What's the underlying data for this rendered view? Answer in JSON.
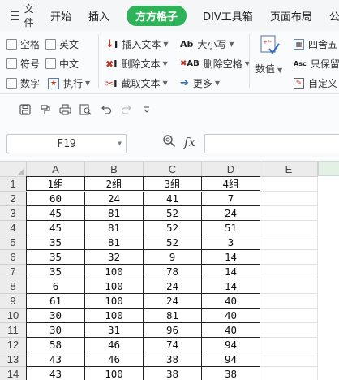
{
  "menu": {
    "file_label": "文件",
    "tabs": [
      "开始",
      "插入",
      "方方格子",
      "DIV工具箱",
      "页面布局",
      "公"
    ],
    "active_tab": "方方格子",
    "accent_color": "#2fb35a"
  },
  "ribbon": {
    "checkboxes": [
      "空格",
      "英文",
      "符号",
      "中文",
      "数字"
    ],
    "execute_label": "执行",
    "text_tools": [
      "插入文本",
      "删除文本",
      "截取文本"
    ],
    "case_tools": [
      "大小写",
      "删除空格",
      "更多"
    ],
    "numeric_label": "数值",
    "right_tools": [
      "四舍五",
      "只保留",
      "自定义"
    ]
  },
  "quick_access": {
    "icons": [
      "save-icon",
      "brush-icon",
      "print-icon",
      "print-preview-icon",
      "undo-icon",
      "redo-icon",
      "customize-icon"
    ]
  },
  "formula_bar": {
    "cell_ref": "F19",
    "fx_label": "fx",
    "formula": ""
  },
  "sheet": {
    "columns": [
      "A",
      "B",
      "C",
      "D",
      "E"
    ],
    "rows": [
      "1",
      "2",
      "3",
      "4",
      "5",
      "6",
      "7",
      "8",
      "9",
      "10",
      "11",
      "12",
      "13",
      "14"
    ],
    "cells": [
      [
        "1组",
        "2组",
        "3组",
        "4组"
      ],
      [
        "60",
        "24",
        "41",
        "7"
      ],
      [
        "45",
        "81",
        "52",
        "24"
      ],
      [
        "45",
        "81",
        "52",
        "51"
      ],
      [
        "35",
        "81",
        "52",
        "3"
      ],
      [
        "35",
        "32",
        "9",
        "14"
      ],
      [
        "35",
        "100",
        "78",
        "14"
      ],
      [
        "6",
        "100",
        "24",
        "14"
      ],
      [
        "61",
        "100",
        "24",
        "40"
      ],
      [
        "30",
        "100",
        "81",
        "40"
      ],
      [
        "30",
        "31",
        "96",
        "40"
      ],
      [
        "58",
        "46",
        "74",
        "94"
      ],
      [
        "43",
        "46",
        "38",
        "94"
      ],
      [
        "43",
        "100",
        "38",
        "38"
      ]
    ]
  }
}
